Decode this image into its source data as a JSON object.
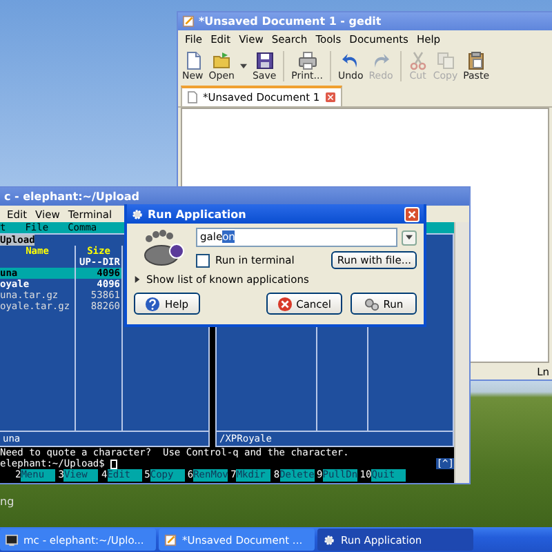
{
  "desktop": {
    "icon_labels": [
      "ng"
    ]
  },
  "gedit": {
    "title": "*Unsaved Document 1 - gedit",
    "menu": [
      "File",
      "Edit",
      "View",
      "Search",
      "Tools",
      "Documents",
      "Help"
    ],
    "toolbar": [
      {
        "kind": "new",
        "label": "New",
        "disabled": false
      },
      {
        "kind": "open",
        "label": "Open",
        "disabled": false
      },
      {
        "kind": "save",
        "label": "Save",
        "disabled": false
      },
      {
        "kind": "print",
        "label": "Print...",
        "disabled": false
      },
      {
        "kind": "undo",
        "label": "Undo",
        "disabled": false
      },
      {
        "kind": "redo",
        "label": "Redo",
        "disabled": true
      },
      {
        "kind": "cut",
        "label": "Cut",
        "disabled": true
      },
      {
        "kind": "copy",
        "label": "Copy",
        "disabled": true
      },
      {
        "kind": "paste",
        "label": "Paste",
        "disabled": false
      }
    ],
    "tabs": [
      {
        "label": "*Unsaved Document 1",
        "selected": true
      }
    ],
    "status": "Ln"
  },
  "terminal": {
    "title": "c - elephant:~/Upload",
    "menu": [
      "Edit",
      "View",
      "Terminal"
    ],
    "mc_menu": [
      "t",
      "File",
      "Comma"
    ],
    "left_panel": {
      "path": "Upload",
      "columns": [
        "Name",
        "Size"
      ],
      "rows": [
        {
          "kind": "updir",
          "size": "UP--DIR",
          "selected": false
        },
        {
          "kind": "dir",
          "name": "una",
          "size": "4096",
          "selected": true
        },
        {
          "kind": "dir",
          "name": "oyale",
          "size": "4096",
          "selected": false
        },
        {
          "kind": "file",
          "name": "una.tar.gz",
          "size": "53861",
          "selected": false
        },
        {
          "kind": "file",
          "name": "oyale.tar.gz",
          "size": "88260",
          "selected": false
        }
      ],
      "footer": "una"
    },
    "right_panel": {
      "footer": "/XPRoyale"
    },
    "hint": "Need to quote a character?  Use Control-q and the character.",
    "prompt": "elephant:~/Upload$",
    "scroll_mark": "[^]",
    "keys": [
      {
        "number": "2",
        "label": "Menu"
      },
      {
        "number": "3",
        "label": "View"
      },
      {
        "number": "4",
        "label": "Edit"
      },
      {
        "number": "5",
        "label": "Copy"
      },
      {
        "number": "6",
        "label": "RenMov"
      },
      {
        "number": "7",
        "label": "Mkdir"
      },
      {
        "number": "8",
        "label": "Delete"
      },
      {
        "number": "9",
        "label": "PullDn"
      },
      {
        "number": "10",
        "label": "Quit"
      }
    ]
  },
  "run_dialog": {
    "title": "Run Application",
    "command_typed": "gale",
    "command_selected": "on",
    "run_in_terminal": false,
    "terminal_label": "Run in terminal",
    "file_button": "Run with file...",
    "expander": {
      "label": "Show list of known applications",
      "expanded": false
    },
    "buttons": [
      {
        "kind": "help",
        "label": "Help"
      },
      {
        "kind": "cancel",
        "label": "Cancel"
      },
      {
        "kind": "run",
        "label": "Run"
      }
    ]
  },
  "taskbar": [
    {
      "kind": "terminal",
      "label": "mc - elephant:~/Uplo...",
      "selected": false
    },
    {
      "kind": "editor",
      "label": "*Unsaved Document ...",
      "selected": false
    },
    {
      "kind": "run",
      "label": "Run Application",
      "selected": true
    }
  ]
}
